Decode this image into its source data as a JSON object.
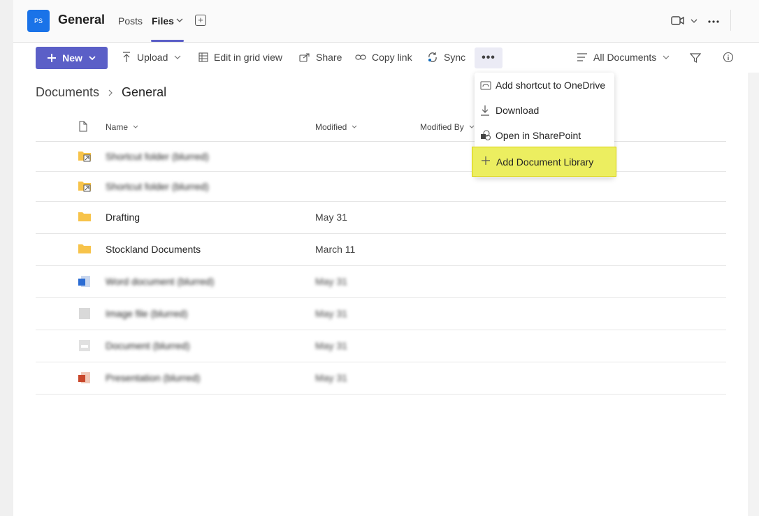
{
  "header": {
    "team_initials": "PS",
    "channel_name": "General",
    "tabs": [
      {
        "label": "Posts"
      },
      {
        "label": "Files"
      }
    ]
  },
  "toolbar": {
    "new_label": "New",
    "upload_label": "Upload",
    "edit_grid_label": "Edit in grid view",
    "share_label": "Share",
    "copy_link_label": "Copy link",
    "sync_label": "Sync",
    "more_label": "•••",
    "view_label": "All Documents"
  },
  "breadcrumb": {
    "root": "Documents",
    "current": "General"
  },
  "table": {
    "columns": [
      "Name",
      "Modified",
      "Modified By"
    ],
    "rows": [
      {
        "name": "Shortcut folder (blurred)",
        "modified": ""
      },
      {
        "name": "Shortcut folder (blurred)",
        "modified": ""
      },
      {
        "name": "Drafting",
        "modified": "May 31"
      },
      {
        "name": "Stockland Documents",
        "modified": "March 11"
      },
      {
        "name": "Word document (blurred)",
        "modified": "May 31"
      },
      {
        "name": "Image file (blurred)",
        "modified": "May 31"
      },
      {
        "name": "Document (blurred)",
        "modified": "May 31"
      },
      {
        "name": "Presentation (blurred)",
        "modified": "May 31"
      }
    ]
  },
  "menu": {
    "items": [
      {
        "label": "Add shortcut to OneDrive"
      },
      {
        "label": "Download"
      },
      {
        "label": "Open in SharePoint"
      },
      {
        "label": "Add Document Library"
      }
    ],
    "highlight_color": "#ecee60"
  },
  "colors": {
    "accent": "#5b5fc7",
    "avatar": "#1a73e8",
    "folder": "#f7c34a"
  }
}
